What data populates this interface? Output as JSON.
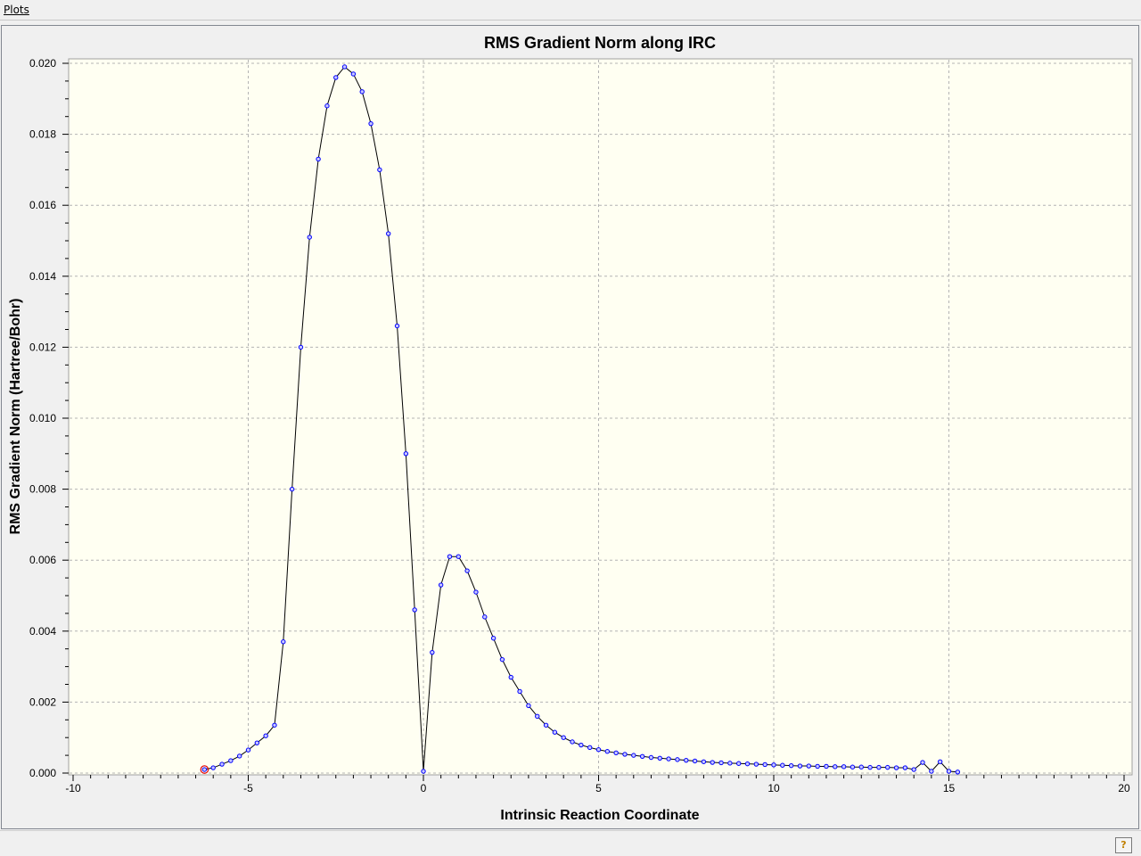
{
  "menu": {
    "plots_label": "Plots"
  },
  "chart_data": {
    "type": "line",
    "title": "RMS Gradient Norm along IRC",
    "xlabel": "Intrinsic Reaction Coordinate",
    "ylabel": "RMS Gradient Norm (Hartree/Bohr)",
    "xlim": [
      -10,
      20
    ],
    "ylim": [
      0.0,
      0.02
    ],
    "x_ticks": [
      "-10",
      "-5",
      "0",
      "5",
      "10",
      "15",
      "20"
    ],
    "y_ticks": [
      "0.000",
      "0.002",
      "0.004",
      "0.006",
      "0.008",
      "0.010",
      "0.012",
      "0.014",
      "0.016",
      "0.018",
      "0.020"
    ],
    "grid": true,
    "legend": "none",
    "colors": {
      "line": "#000000",
      "marker_edge": "#0000ff",
      "marker_fill": "#c8c8ff",
      "highlight": "#e00000",
      "plot_bg": "#fffff2"
    },
    "series": [
      {
        "x": [
          -6.25,
          -6.0,
          -5.75,
          -5.5,
          -5.25,
          -5.0,
          -4.75,
          -4.5,
          -4.25,
          -4.0,
          -3.75,
          -3.5,
          -3.25,
          -3.0,
          -2.75,
          -2.5,
          -2.25,
          -2.0,
          -1.75,
          -1.5,
          -1.25,
          -1.0,
          -0.75,
          -0.5,
          -0.25,
          0.0,
          0.25,
          0.5,
          0.75,
          1.0,
          1.25,
          1.5,
          1.75,
          2.0,
          2.25,
          2.5,
          2.75,
          3.0,
          3.25,
          3.5,
          3.75,
          4.0,
          4.25,
          4.5,
          4.75,
          5.0,
          5.25,
          5.5,
          5.75,
          6.0,
          6.25,
          6.5,
          6.75,
          7.0,
          7.25,
          7.5,
          7.75,
          8.0,
          8.25,
          8.5,
          8.75,
          9.0,
          9.25,
          9.5,
          9.75,
          10.0,
          10.25,
          10.5,
          10.75,
          11.0,
          11.25,
          11.5,
          11.75,
          12.0,
          12.25,
          12.5,
          12.75,
          13.0,
          13.25,
          13.5,
          13.75,
          14.0,
          14.25,
          14.5,
          14.75,
          15.0,
          15.25
        ],
        "y": [
          0.0001,
          0.00015,
          0.00025,
          0.00035,
          0.00048,
          0.00065,
          0.00085,
          0.00105,
          0.00135,
          0.0037,
          0.008,
          0.012,
          0.0151,
          0.0173,
          0.0188,
          0.0196,
          0.0199,
          0.0197,
          0.0192,
          0.0183,
          0.017,
          0.0152,
          0.0126,
          0.009,
          0.0046,
          5e-05,
          0.0034,
          0.0053,
          0.0061,
          0.0061,
          0.0057,
          0.0051,
          0.0044,
          0.0038,
          0.0032,
          0.0027,
          0.0023,
          0.0019,
          0.0016,
          0.00135,
          0.00115,
          0.001,
          0.00088,
          0.00079,
          0.00072,
          0.00066,
          0.00061,
          0.00057,
          0.00053,
          0.0005,
          0.00047,
          0.00044,
          0.00042,
          0.0004,
          0.00038,
          0.00036,
          0.00034,
          0.00032,
          0.0003,
          0.00029,
          0.00028,
          0.00027,
          0.00026,
          0.00025,
          0.00024,
          0.00023,
          0.00022,
          0.00021,
          0.0002,
          0.0002,
          0.00019,
          0.00019,
          0.00018,
          0.00018,
          0.00017,
          0.00017,
          0.00016,
          0.00016,
          0.00016,
          0.00015,
          0.00015,
          0.0001,
          0.0003,
          5e-05,
          0.00032,
          5e-05,
          3e-05
        ],
        "highlight_index": 0
      }
    ]
  }
}
